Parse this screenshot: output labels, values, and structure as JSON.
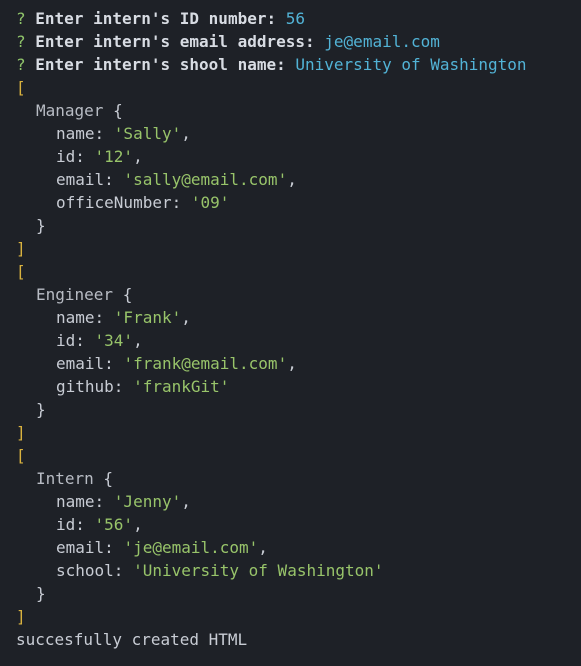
{
  "prompts": [
    {
      "mark": "?",
      "question": "Enter intern's ID number:",
      "answer": "56"
    },
    {
      "mark": "?",
      "question": "Enter intern's email address:",
      "answer": "je@email.com"
    },
    {
      "mark": "?",
      "question": "Enter intern's shool name:",
      "answer": "University of Washington"
    }
  ],
  "objects": [
    {
      "class": "Manager",
      "fields": [
        {
          "key": "name",
          "value": "'Sally'"
        },
        {
          "key": "id",
          "value": "'12'"
        },
        {
          "key": "email",
          "value": "'sally@email.com'"
        },
        {
          "key": "officeNumber",
          "value": "'09'"
        }
      ]
    },
    {
      "class": "Engineer",
      "fields": [
        {
          "key": "name",
          "value": "'Frank'"
        },
        {
          "key": "id",
          "value": "'34'"
        },
        {
          "key": "email",
          "value": "'frank@email.com'"
        },
        {
          "key": "github",
          "value": "'frankGit'"
        }
      ]
    },
    {
      "class": "Intern",
      "fields": [
        {
          "key": "name",
          "value": "'Jenny'"
        },
        {
          "key": "id",
          "value": "'56'"
        },
        {
          "key": "email",
          "value": "'je@email.com'"
        },
        {
          "key": "school",
          "value": "'University of Washington'"
        }
      ]
    }
  ],
  "syntax": {
    "open_bracket": "[",
    "close_bracket": "]",
    "open_brace": " {",
    "close_brace": "}",
    "colon": ": ",
    "comma": ","
  },
  "status_message": "succesfully created HTML",
  "colors": {
    "background": "#1e2127",
    "prompt_mark": "#8fc46a",
    "answer": "#52b3d6",
    "string": "#98c46a",
    "bracket": "#d9b23f"
  }
}
